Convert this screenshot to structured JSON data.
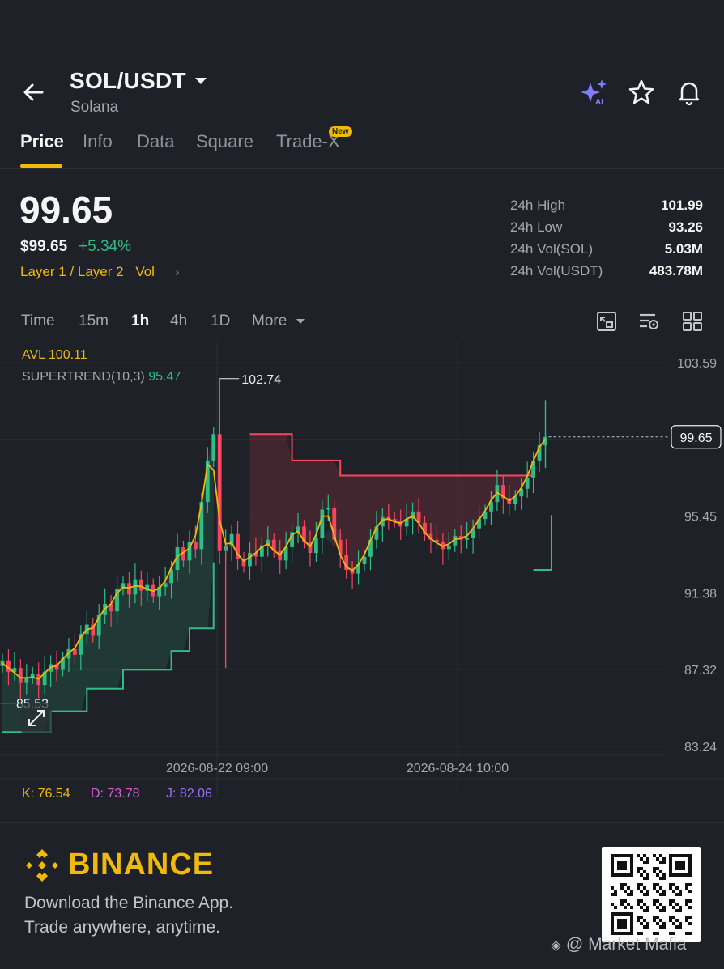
{
  "header": {
    "pair": "SOL/USDT",
    "name": "Solana",
    "icons": [
      "back-arrow-icon",
      "ai-sparkle-icon",
      "star-icon",
      "bell-icon"
    ]
  },
  "tabs": [
    {
      "label": "Price",
      "active": true
    },
    {
      "label": "Info"
    },
    {
      "label": "Data"
    },
    {
      "label": "Square"
    },
    {
      "label": "Trade-X",
      "badge": "New"
    }
  ],
  "price": {
    "last": "99.65",
    "usd": "$99.65",
    "change": "+5.34%",
    "tags": "Layer 1 / Layer 2",
    "vol_tag": "Vol"
  },
  "stats": [
    {
      "label": "24h High",
      "value": "101.99"
    },
    {
      "label": "24h Low",
      "value": "93.26"
    },
    {
      "label": "24h Vol(SOL)",
      "value": "5.03M"
    },
    {
      "label": "24h Vol(USDT)",
      "value": "483.78M"
    }
  ],
  "timeframes": [
    {
      "label": "Time"
    },
    {
      "label": "15m"
    },
    {
      "label": "1h",
      "active": true
    },
    {
      "label": "4h"
    },
    {
      "label": "1D"
    },
    {
      "label": "More"
    }
  ],
  "indicators": {
    "avl_label": "AVL 100.11",
    "supertrend_label": "SUPERTREND(10,3)",
    "supertrend_value": "95.47",
    "k": "K: 76.54",
    "d": "D: 73.78",
    "j": "J: 82.06"
  },
  "chart_data": {
    "type": "candlestick",
    "ylim": [
      83.24,
      103.59
    ],
    "y_ticks": [
      "103.59",
      "99.52",
      "95.45",
      "91.38",
      "87.32",
      "83.24"
    ],
    "x_tick_labels": [
      "2026-08-22 09:00",
      "2026-08-24 10:00"
    ],
    "last_price_label": "99.65",
    "last_price": 99.65,
    "high_marker_label": "102.74",
    "high_marker": 102.74,
    "low_marker_label": "85.53",
    "low_marker": 85.53,
    "close_series": [
      87.8,
      87.2,
      87.4,
      86.6,
      86.9,
      87.1,
      86.5,
      87.2,
      87.6,
      87.3,
      87.9,
      88.4,
      88.1,
      89.2,
      89.7,
      89.1,
      90.2,
      90.8,
      90.4,
      91.6,
      91.9,
      91.3,
      92.1,
      91.5,
      91.8,
      91.2,
      91.7,
      91.9,
      92.6,
      93.8,
      93.1,
      94.1,
      93.7,
      96.2,
      98.4,
      99.8,
      93.6,
      93.9,
      94.5,
      93.2,
      92.8,
      93.5,
      93.3,
      93.9,
      94.2,
      93.6,
      93.1,
      93.8,
      94.6,
      94.9,
      94.1,
      93.5,
      94.3,
      95.8,
      95.9,
      94.2,
      93.4,
      92.6,
      92.4,
      92.9,
      93.3,
      94.2,
      94.9,
      95.4,
      95.3,
      95.2,
      94.9,
      95.3,
      95.7,
      95.1,
      94.5,
      94.2,
      94.1,
      93.7,
      93.9,
      94.4,
      94.2,
      94.3,
      94.8,
      95.3,
      95.7,
      96.2,
      97.1,
      96.4,
      96.1,
      96.5,
      96.9,
      97.5,
      98.4,
      99.2,
      99.65
    ],
    "candle_start_x": 3,
    "candle_spacing_x": 7.45,
    "supertrend_lower": [
      {
        "i": 0,
        "v": 84.0
      },
      {
        "i": 8,
        "v": 85.1
      },
      {
        "i": 14,
        "v": 86.3
      },
      {
        "i": 20,
        "v": 87.3
      },
      {
        "i": 28,
        "v": 88.3
      },
      {
        "i": 31,
        "v": 89.5
      },
      {
        "i": 35,
        "v": 93.0
      }
    ],
    "supertrend_upper": [
      {
        "i": 41,
        "v": 99.8
      },
      {
        "i": 48,
        "v": 98.4
      },
      {
        "i": 56,
        "v": 97.6
      },
      {
        "i": 88,
        "v": 97.6
      }
    ],
    "supertrend_lower2": [
      {
        "i": 88,
        "v": 92.6
      },
      {
        "i": 91,
        "v": 95.5
      }
    ],
    "colors": {
      "up": "#2ebd85",
      "down": "#f6465d",
      "avl": "#f0b90b",
      "trend_up": "#2ebd85",
      "trend_down": "#f6465d"
    }
  },
  "footer": {
    "brand": "BINANCE",
    "line1": "Download the Binance App.",
    "line2": "Trade anywhere, anytime.",
    "watermark": "@ Market Mafia"
  }
}
